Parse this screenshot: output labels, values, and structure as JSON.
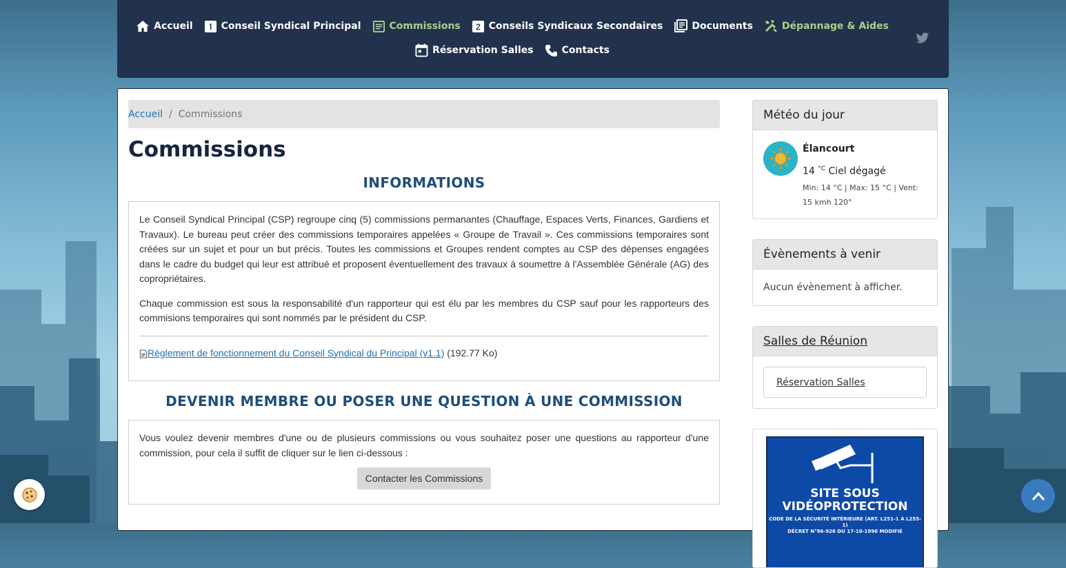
{
  "nav": {
    "row1": [
      {
        "label": "Accueil",
        "icon": "home-icon",
        "active": false
      },
      {
        "label": "Conseil Syndical Principal",
        "icon": "number-1-icon",
        "active": false
      },
      {
        "label": "Commissions",
        "icon": "article-icon",
        "active": true
      },
      {
        "label": "Conseils Syndicaux Secondaires",
        "icon": "number-2-icon",
        "active": false
      },
      {
        "label": "Documents",
        "icon": "library-books-icon",
        "active": false
      },
      {
        "label": "Dépannage & Aides",
        "icon": "tools-icon",
        "active": true
      }
    ],
    "row2": [
      {
        "label": "Réservation Salles",
        "icon": "calendar-icon"
      },
      {
        "label": "Contacts",
        "icon": "phone-icon"
      }
    ],
    "social_icon": "twitter-icon"
  },
  "breadcrumb": {
    "home": "Accueil",
    "separator": "/",
    "current": "Commissions"
  },
  "page": {
    "title": "Commissions",
    "info_heading": "INFORMATIONS",
    "info_p1": "Le Conseil Syndical Principal (CSP) regroupe cinq (5) commissions permanantes (Chauffage, Espaces Verts, Finances, Gardiens et Travaux). Le bureau peut créer des commissions temporaires appelées « Groupe de  Travail ». Ces commissions temporaires sont créées sur un sujet et pour un but précis. Toutes les commissions et Groupes rendent comptes au CSP des dépenses engagées dans le cadre du budget qui leur est attribué et proposent éventuellement des travaux à soumettre à l'Assemblée Générale (AG) des copropriétaires.",
    "info_p2": "Chaque commission est sous la responsabilité d'un rapporteur qui est élu par les membres du CSP sauf pour les rapporteurs des commisions temporaires qui sont nommés par le président du CSP.",
    "attachment_label": "Règlement de fonctionnement du Conseil Syndical du Principal (v1.1)",
    "attachment_size": "(192.77 Ko)",
    "member_heading": "DEVENIR MEMBRE OU POSER UNE QUESTION À UNE COMMISSION",
    "member_text": "Vous voulez devenir membres d'une ou de plusieurs commissions ou  vous souhaitez poser une questions au rapporteur d'une commission, pour cela il suffit de cliquer sur le lien ci-dessous :",
    "contact_button": "Contacter les Commissions"
  },
  "sidebar": {
    "meteo": {
      "title": "Météo du jour",
      "city": "Élancourt",
      "temp": "14",
      "unit": "°C",
      "condition": "Ciel dégagé",
      "details": "Min: 14 °C | Max: 15 °C | Vent: 15 kmh 120°"
    },
    "events": {
      "title": "Évènements à venir",
      "empty": "Aucun évènement à afficher."
    },
    "rooms": {
      "title": "Salles de Réunion",
      "link": "Réservation Salles"
    },
    "video": {
      "line1": "SITE SOUS",
      "line2": "VIDÉOPROTECTION",
      "line3": "CODE DE LA SÉCURITÉ INTÉRIEURE (ART. L251-1 À L255-1)",
      "line4": "DÉCRET N°96-926 DU 17-10-1996 MODIFIÉ"
    }
  },
  "colors": {
    "navbar": "#22314c",
    "active": "#a9d18e",
    "title": "#18253f",
    "heading": "#1f4e79",
    "link": "#1f6fb0"
  }
}
